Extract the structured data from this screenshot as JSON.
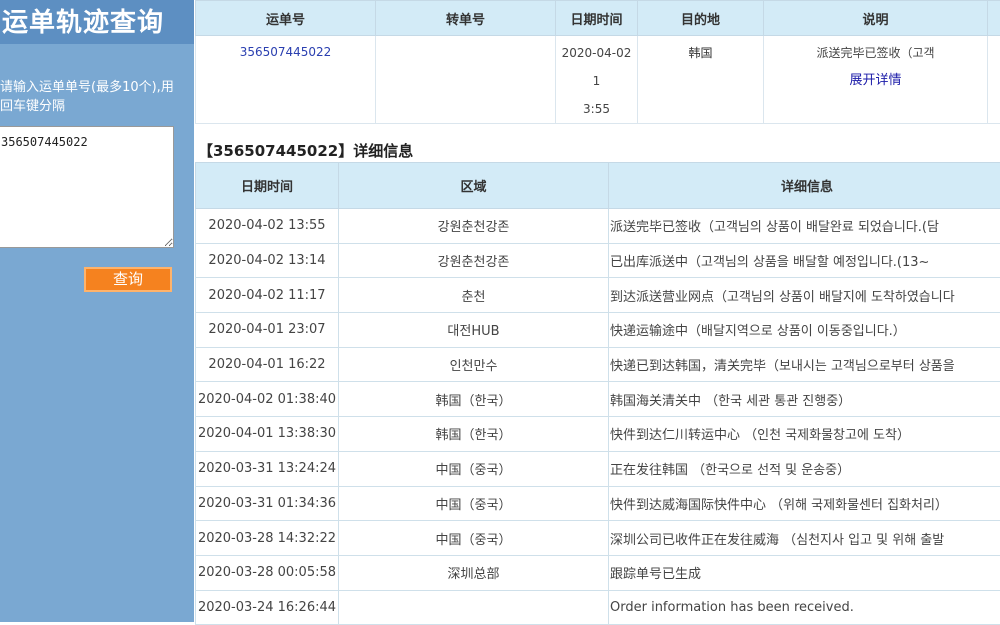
{
  "sidebar": {
    "title": "运单轨迹查询",
    "hint_line1": "请输入运单单号(最多10个),用",
    "hint_line2": "回车键分隔",
    "input_value": "356507445022",
    "query_button": "查询"
  },
  "summary": {
    "headers": [
      "运单号",
      "转单号",
      "日期时间",
      "目的地",
      "说明"
    ],
    "row": {
      "waybill": "356507445022",
      "transfer": "",
      "datetime_line1": "2020-04-02 1",
      "datetime_line2": "3:55",
      "destination": "韩国",
      "description": "派送完毕已签收（고객",
      "expand_link": "展开详情"
    }
  },
  "detail": {
    "title": "【356507445022】详细信息",
    "headers": [
      "日期时间",
      "区域",
      "详细信息"
    ],
    "rows": [
      {
        "date": "2020-04-02 13:55",
        "area": "강원춘천강존",
        "info": "派送完毕已签收（고객님의 상품이 배달완료 되었습니다.(담"
      },
      {
        "date": "2020-04-02 13:14",
        "area": "강원춘천강존",
        "info": "已出库派送中（고객님의 상품을 배달할 예정입니다.(13~"
      },
      {
        "date": "2020-04-02 11:17",
        "area": "춘천",
        "info": "到达派送营业网点（고객님의 상품이 배달지에 도착하였습니다"
      },
      {
        "date": "2020-04-01 23:07",
        "area": "대전HUB",
        "info": " 快递运输途中（배달지역으로 상품이 이동중입니다.）"
      },
      {
        "date": "2020-04-01 16:22",
        "area": "인천만수",
        "info": "快递已到达韩国，清关完毕（보내시는 고객님으로부터 상품을"
      },
      {
        "date": "2020-04-02 01:38:40",
        "area": "韩国（한국）",
        "info": " 韩国海关清关中 （한국 세관 통관 진행중）"
      },
      {
        "date": "2020-04-01 13:38:30",
        "area": "韩国（한국）",
        "info": " 快件到达仁川转运中心 （인천 국제화물창고에 도착）"
      },
      {
        "date": "2020-03-31 13:24:24",
        "area": "中国（중국）",
        "info": " 正在发往韩国 （한국으로 선적 및 운송중）"
      },
      {
        "date": "2020-03-31 01:34:36",
        "area": "中国（중국）",
        "info": " 快件到达威海国际快件中心 （위해 국제화물센터 집화처리）"
      },
      {
        "date": "2020-03-28 14:32:22",
        "area": "中国（중국）",
        "info": "深圳公司已收件正在发往威海 （심천지사 입고 및 위해 출발"
      },
      {
        "date": "2020-03-28 00:05:58",
        "area": "深圳总部",
        "info": " 跟踪单号已生成"
      },
      {
        "date": "2020-03-24 16:26:44",
        "area": "",
        "info": " Order information has been received."
      }
    ]
  }
}
